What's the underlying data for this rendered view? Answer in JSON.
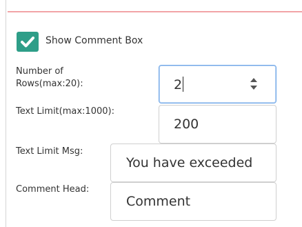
{
  "comment_box": {
    "checked": true,
    "label": "Show Comment Box"
  },
  "rows": {
    "label": "Number of Rows(max:20):",
    "value": "2"
  },
  "text_limit": {
    "label": "Text Limit(max:1000):",
    "value": "200"
  },
  "text_limit_msg": {
    "label": "Text Limit Msg:",
    "value": "You have exceeded"
  },
  "comment_head": {
    "label": "Comment Head:",
    "value": "Comment"
  },
  "colors": {
    "checkbox": "#2e9e88",
    "divider": "#f2a3a6",
    "focus_border": "#6fa7e8"
  }
}
